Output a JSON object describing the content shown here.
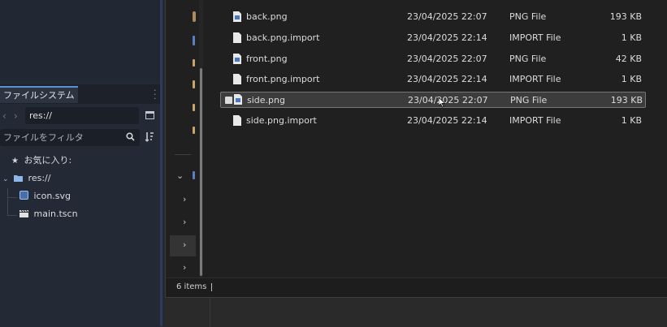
{
  "dock": {
    "tab_title": "ファイルシステム",
    "path_value": "res://",
    "filter_placeholder": "ファイルをフィルタ",
    "tree": {
      "favorites_label": "お気に入り:",
      "root_label": "res://",
      "items": [
        {
          "label": "icon.svg",
          "icon": "svg-file-icon"
        },
        {
          "label": "main.tscn",
          "icon": "scene-clapper-icon"
        }
      ]
    }
  },
  "dialog": {
    "files": [
      {
        "name": "back.png",
        "date": "23/04/2025 22:07",
        "type": "PNG File",
        "size": "193 KB",
        "icon": "image-file-icon"
      },
      {
        "name": "back.png.import",
        "date": "23/04/2025 22:14",
        "type": "IMPORT File",
        "size": "1 KB",
        "icon": "text-file-icon"
      },
      {
        "name": "front.png",
        "date": "23/04/2025 22:07",
        "type": "PNG File",
        "size": "42 KB",
        "icon": "image-file-icon"
      },
      {
        "name": "front.png.import",
        "date": "23/04/2025 22:14",
        "type": "IMPORT File",
        "size": "1 KB",
        "icon": "text-file-icon"
      },
      {
        "name": "side.png",
        "date": "23/04/2025 22:07",
        "type": "PNG File",
        "size": "193 KB",
        "icon": "image-file-icon",
        "selected": true
      },
      {
        "name": "side.png.import",
        "date": "23/04/2025 22:14",
        "type": "IMPORT File",
        "size": "1 KB",
        "icon": "text-file-icon"
      }
    ],
    "status_text": "6 items"
  },
  "colors": {
    "dock_bg": "#232a35",
    "dialog_bg": "#202020",
    "accent": "#5c8fd6",
    "selection_bg": "#3c3c3c",
    "folder_icon": "#8fb6e8"
  }
}
